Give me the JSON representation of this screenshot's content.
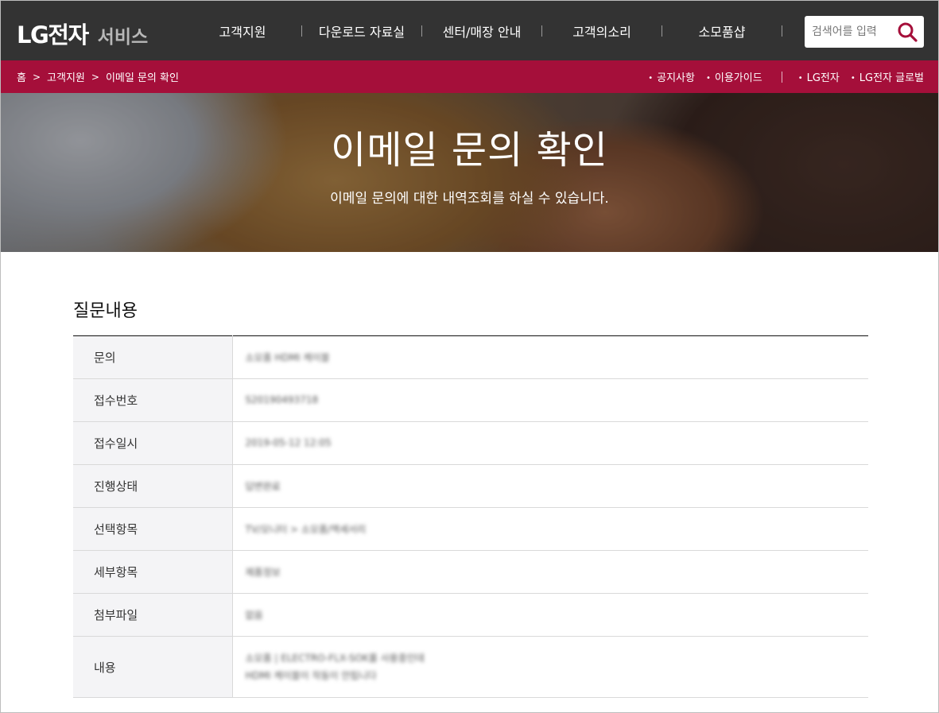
{
  "header": {
    "logo_main": "LG전자",
    "logo_sub": "서비스",
    "menu": [
      {
        "label": "고객지원",
        "name": "nav-customer-support"
      },
      {
        "label": "다운로드 자료실",
        "name": "nav-downloads"
      },
      {
        "label": "센터/매장 안내",
        "name": "nav-center-store"
      },
      {
        "label": "고객의소리",
        "name": "nav-voice-of-customer"
      },
      {
        "label": "소모품샵",
        "name": "nav-consumables-shop"
      }
    ],
    "search": {
      "placeholder": "검색어를 입력"
    }
  },
  "breadcrumb": {
    "home": "홈",
    "level1": "고객지원",
    "current": "이메일 문의 확인"
  },
  "utility_links": [
    "공지사항",
    "이용가이드",
    "LG전자",
    "LG전자 글로벌"
  ],
  "hero": {
    "title": "이메일 문의 확인",
    "subtitle": "이메일 문의에 대한 내역조회를 하실 수 있습니다."
  },
  "section": {
    "title": "질문내용"
  },
  "table": {
    "rows": [
      {
        "label": "문의",
        "value": "소모품 HDMI 케이블"
      },
      {
        "label": "접수번호",
        "value": "S20190493718"
      },
      {
        "label": "접수일시",
        "value": "2019-05-12 12:05"
      },
      {
        "label": "진행상태",
        "value": "답변완료"
      },
      {
        "label": "선택항목",
        "value": "TV/모니터 > 소모품/액세서리"
      },
      {
        "label": "세부항목",
        "value": "제품정보"
      },
      {
        "label": "첨부파일",
        "value": "없음"
      },
      {
        "label": "내용",
        "value_lines": [
          "소모품 | ELECTRO-FLX-SOK를 사용중인데",
          "HDMI 케이블이 작동이 안됩니다"
        ]
      }
    ]
  }
}
